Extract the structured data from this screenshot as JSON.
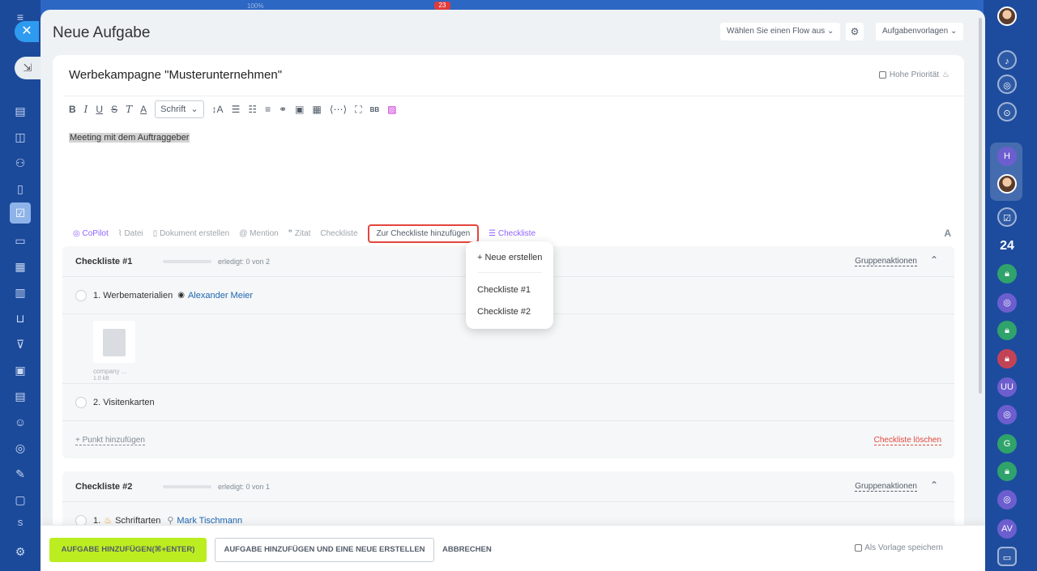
{
  "topbar": {
    "percent": "100%",
    "badge": "23"
  },
  "header": {
    "title": "Neue Aufgabe",
    "flow_select": "Wählen Sie einen Flow aus",
    "templates": "Aufgabenvorlagen"
  },
  "task": {
    "title": "Werbekampagne \"Musterunternehmen\"",
    "high_priority": "Hohe Priorität",
    "body": "Meeting mit dem Auftraggeber"
  },
  "toolbar": {
    "font_label": "Schrift"
  },
  "actions": {
    "copilot": "CoPilot",
    "file": "Datei",
    "create_doc": "Dokument erstellen",
    "mention": "Mention",
    "quote": "Zitat",
    "checklist": "Checkliste",
    "add_to_checklist": "Zur Checkliste hinzufügen",
    "checklist_ai": "Checkliste"
  },
  "dropdown": {
    "new": "+ Neue erstellen",
    "items": [
      "Checkliste #1",
      "Checkliste #2"
    ]
  },
  "checklists": [
    {
      "title": "Checkliste #1",
      "done": "erledigt: 0 von 2",
      "group_actions": "Gruppenaktionen",
      "items": [
        {
          "text": "1. Werbematerialien",
          "member": "Alexander Meier"
        },
        {
          "text": "2. Visitenkarten"
        }
      ],
      "file": {
        "name": "company ...",
        "size": "1.0 kB"
      },
      "add_item": "+ Punkt hinzufügen",
      "delete": "Checkliste löschen"
    },
    {
      "title": "Checkliste #2",
      "done": "erledigt: 0 von 1",
      "group_actions": "Gruppenaktionen",
      "items": [
        {
          "text": "1.",
          "label": "Schriftarten",
          "member": "Mark Tischmann"
        }
      ]
    }
  ],
  "footer": {
    "submit": "AUFGABE HINZUFÜGEN(⌘+ENTER)",
    "submit_new": "AUFGABE HINZUFÜGEN UND EINE NEUE ERSTELLEN",
    "cancel": "ABBRECHEN",
    "save_template": "Als Vorlage speichern"
  },
  "right_rail": {
    "counter": "24",
    "initials": [
      "H",
      "UU",
      "G",
      "AV",
      "S"
    ]
  },
  "colors": {
    "accent_green": "#bbed21",
    "highlight_red": "#e4463c",
    "link_blue": "#2066b0",
    "copilot_purple": "#8f63ff"
  }
}
